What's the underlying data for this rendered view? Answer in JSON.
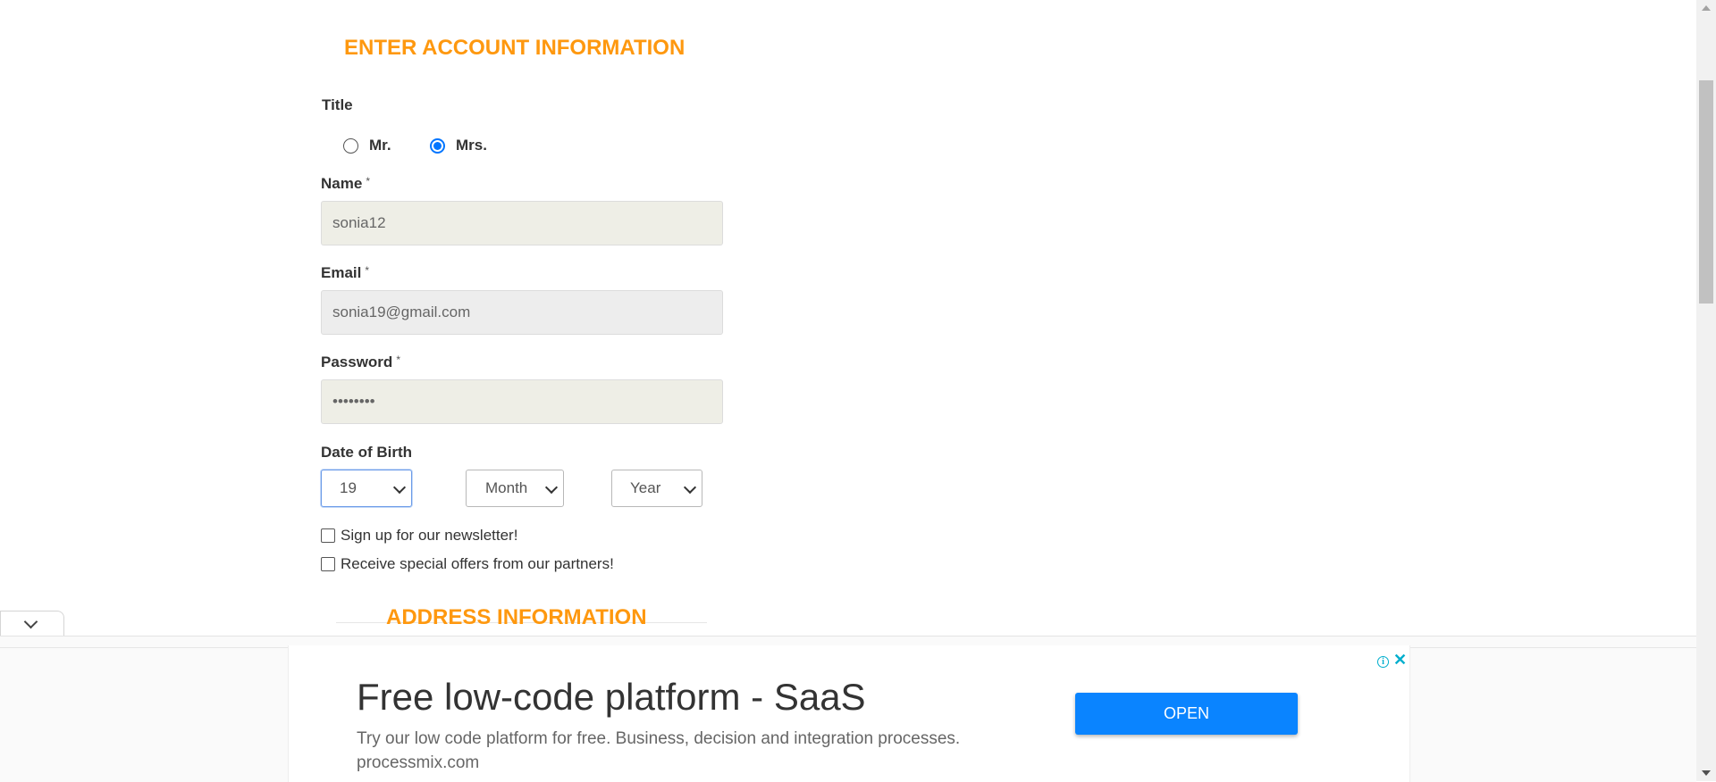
{
  "account": {
    "heading": "ENTER ACCOUNT INFORMATION",
    "title_label": "Title",
    "title_options": [
      {
        "label": "Mr.",
        "checked": false
      },
      {
        "label": "Mrs.",
        "checked": true
      }
    ],
    "name_label": "Name",
    "name_value": "sonia12",
    "email_label": "Email",
    "email_value": "sonia19@gmail.com",
    "password_label": "Password",
    "password_value": "••••••••",
    "required_mark": "*",
    "dob_label": "Date of Birth",
    "dob_day": "19",
    "dob_month": "Month",
    "dob_year": "Year",
    "newsletter_label": "Sign up for our newsletter!",
    "offers_label": "Receive special offers from our partners!"
  },
  "address": {
    "heading": "ADDRESS INFORMATION"
  },
  "ad": {
    "headline": "Free low-code platform - SaaS",
    "description": "Try our low code platform for free. Business, decision and integration processes.",
    "domain": "processmix.com",
    "button_label": "OPEN",
    "info_glyph": "i",
    "close_glyph": "✕"
  },
  "colors": {
    "heading": "#fe980f",
    "ad_button": "#0a84ff",
    "radio_checked": "#0075ff"
  }
}
